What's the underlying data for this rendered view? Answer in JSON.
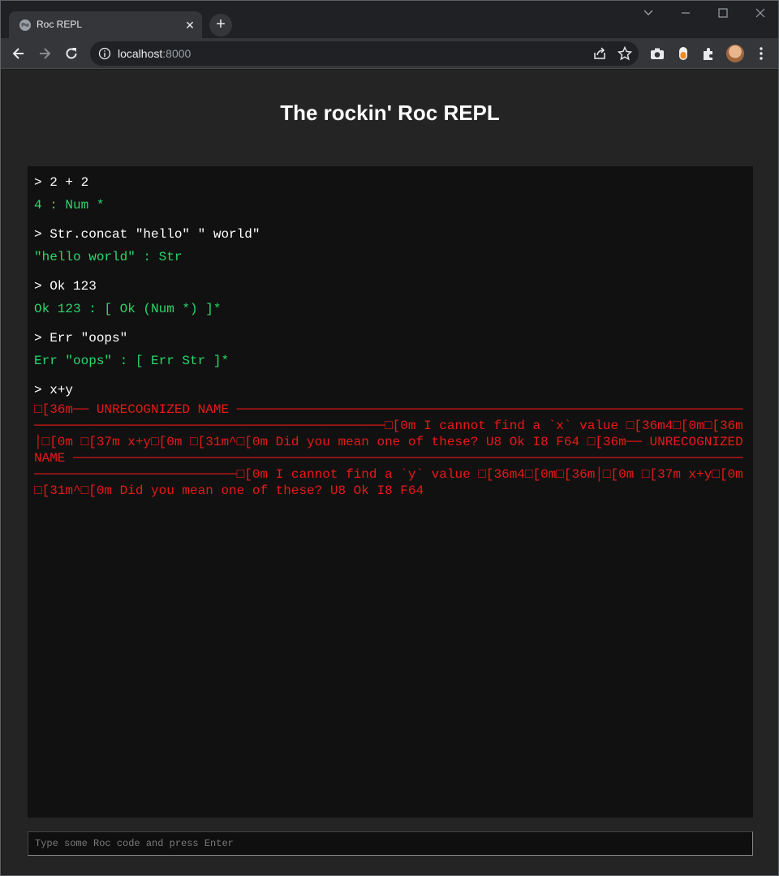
{
  "browser": {
    "tab_title": "Roc REPL",
    "url_host": "localhost",
    "url_port": ":8000"
  },
  "page": {
    "title": "The rockin' Roc REPL"
  },
  "history": [
    {
      "input": "> 2 + 2",
      "output": "4 : Num *",
      "kind": "ok"
    },
    {
      "input": "> Str.concat \"hello\" \" world\"",
      "output": "\"hello world\" : Str",
      "kind": "ok"
    },
    {
      "input": "> Ok 123",
      "output": "Ok 123 : [ Ok (Num *) ]*",
      "kind": "ok"
    },
    {
      "input": "> Err \"oops\"",
      "output": "Err \"oops\" : [ Err Str ]*",
      "kind": "ok"
    },
    {
      "input": "> x+y",
      "output": "□[36m── UNRECOGNIZED NAME ──────────────────────────────────────────────────────────────────────────────────────────────────────────────□[0m I cannot find a `x` value □[36m4□[0m□[36m│□[0m □[37m x+y□[0m □[31m^□[0m Did you mean one of these? U8 Ok I8 F64 □[36m── UNRECOGNIZED NAME ────────────────────────────────────────────────────────────────────────────────────────────────────────────────□[0m I cannot find a `y` value □[36m4□[0m□[36m│□[0m □[37m x+y□[0m □[31m^□[0m Did you mean one of these? U8 Ok I8 F64",
      "kind": "error"
    }
  ],
  "repl_input": {
    "placeholder": "Type some Roc code and press Enter",
    "value": ""
  },
  "colors": {
    "page_bg": "#242424",
    "history_bg": "#111111",
    "input_text": "#ffffff",
    "ok_output": "#2bd76b",
    "error_output": "#e8191a"
  }
}
